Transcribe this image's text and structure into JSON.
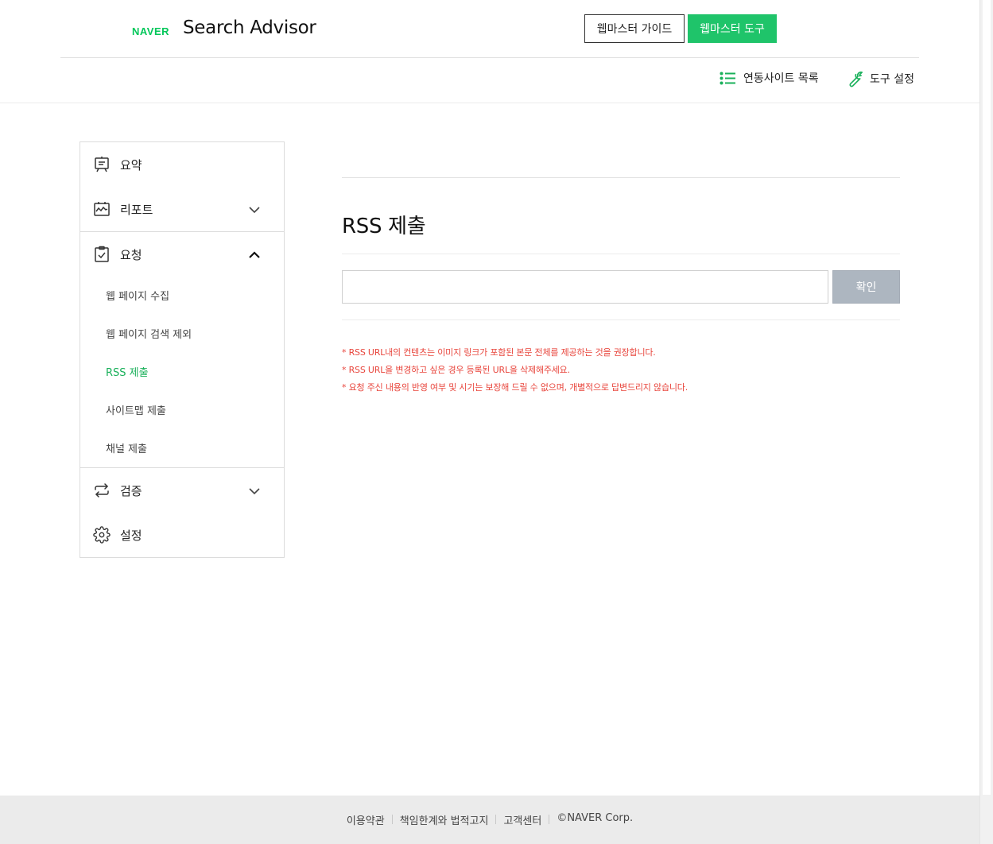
{
  "header": {
    "logo": "NAVER",
    "product": "Search Advisor",
    "guide_button": "웹마스터 가이드",
    "tool_button": "웹마스터 도구",
    "sites_link": "연동사이트 목록",
    "tools_link": "도구 설정"
  },
  "sidebar": {
    "summary": "요약",
    "report": "리포트",
    "request": "요청",
    "request_items": [
      "웹 페이지 수집",
      "웹 페이지 검색 제외",
      "RSS 제출",
      "사이트맵 제출",
      "채널 제출"
    ],
    "verify": "검증",
    "settings": "설정"
  },
  "main": {
    "title": "RSS 제출",
    "input_value": "",
    "confirm_button": "확인",
    "notes": [
      "* RSS URL내의 컨텐츠는 이미지 링크가 포함된 본문 전체를 제공하는 것을 권장합니다.",
      "* RSS URL을 변경하고 싶은 경우 등록된 URL을 삭제해주세요.",
      "* 요청 주신 내용의 반영 여부 및 시기는 보장해 드릴 수 없으며, 개별적으로 답변드리지 않습니다."
    ]
  },
  "footer": {
    "links": [
      "이용약관",
      "책임한계와 법적고지",
      "고객센터"
    ],
    "copyright": "©NAVER Corp."
  },
  "colors": {
    "brand_green": "#03c75a",
    "notice_red": "#e8453c",
    "disabled_button": "#adb6c0"
  }
}
